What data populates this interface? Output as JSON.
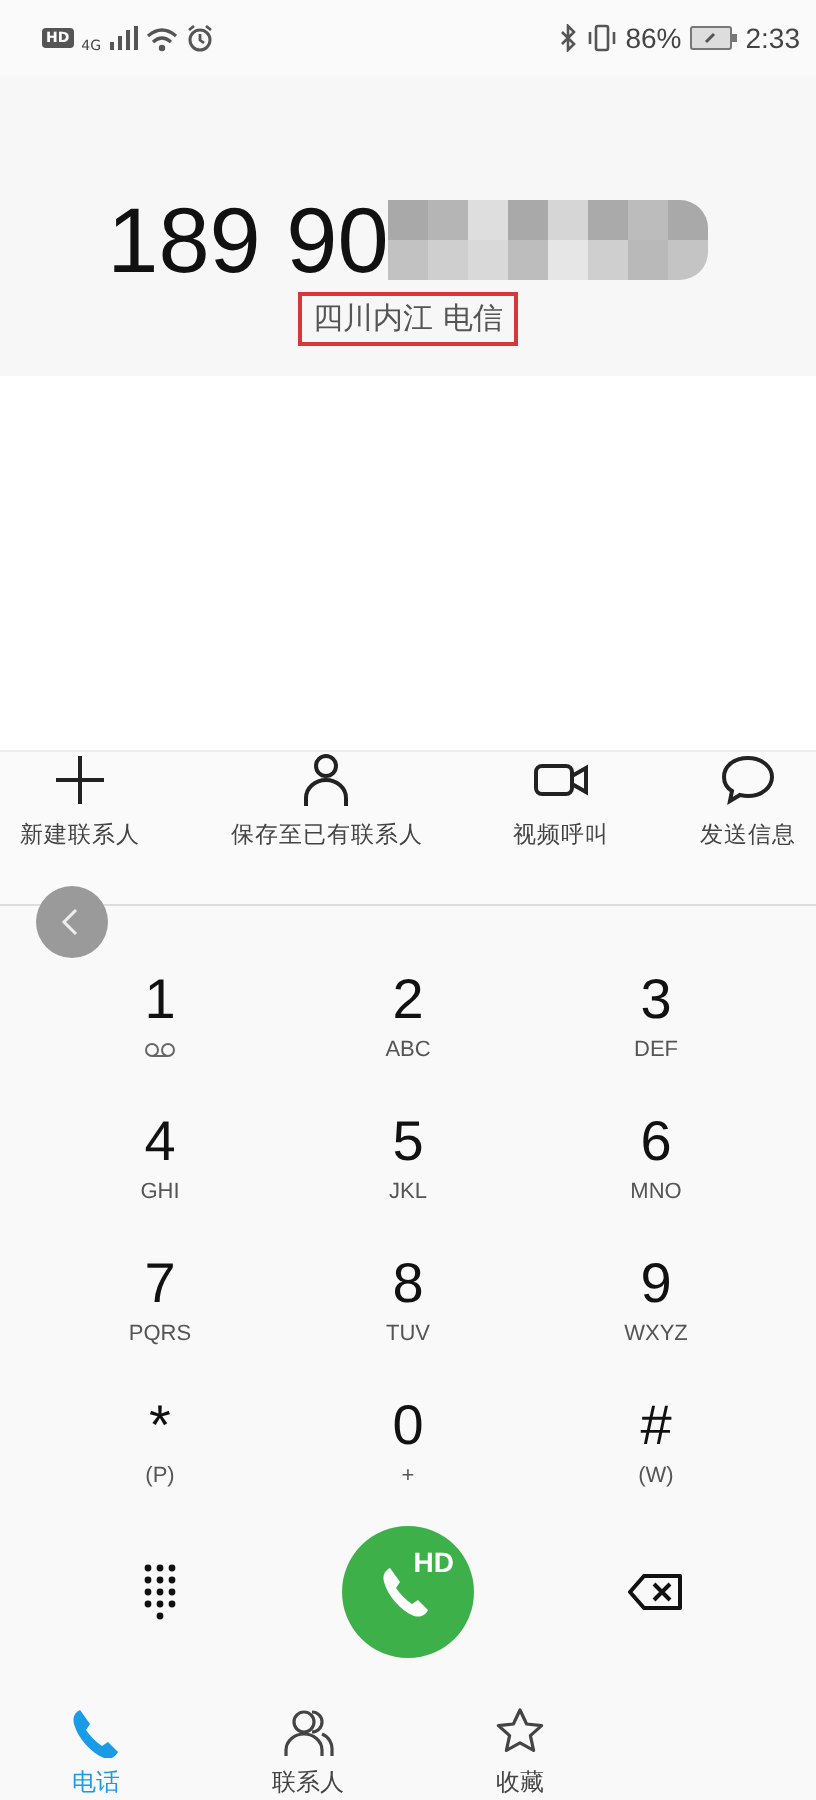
{
  "status_bar": {
    "hd": "HD",
    "network": "4G",
    "battery": "86%",
    "time": "2:33"
  },
  "display": {
    "number": "189 90",
    "redacted": true,
    "location": "四川内江 电信",
    "location_highlighted": true
  },
  "actions": [
    {
      "kind": "add",
      "label": "新建联系人"
    },
    {
      "kind": "person",
      "label": "保存至已有联系人"
    },
    {
      "kind": "video",
      "label": "视频呼叫"
    },
    {
      "kind": "message",
      "label": "发送信息"
    }
  ],
  "keys": [
    {
      "digit": "1",
      "kind": "voicemail"
    },
    {
      "digit": "2",
      "sub": "ABC"
    },
    {
      "digit": "3",
      "sub": "DEF"
    },
    {
      "digit": "4",
      "sub": "GHI"
    },
    {
      "digit": "5",
      "sub": "JKL"
    },
    {
      "digit": "6",
      "sub": "MNO"
    },
    {
      "digit": "7",
      "sub": "PQRS"
    },
    {
      "digit": "8",
      "sub": "TUV"
    },
    {
      "digit": "9",
      "sub": "WXYZ"
    },
    {
      "digit": "*",
      "sub": "(P)",
      "kind": "symbol"
    },
    {
      "digit": "0",
      "sub": "+"
    },
    {
      "digit": "#",
      "sub": "(W)",
      "kind": "symbol"
    }
  ],
  "call_button": {
    "badge": "HD"
  },
  "nav": [
    {
      "kind": "phone",
      "label": "电话",
      "selected": true
    },
    {
      "kind": "contacts",
      "label": "联系人",
      "selected": false
    },
    {
      "kind": "star",
      "label": "收藏",
      "selected": false
    }
  ]
}
